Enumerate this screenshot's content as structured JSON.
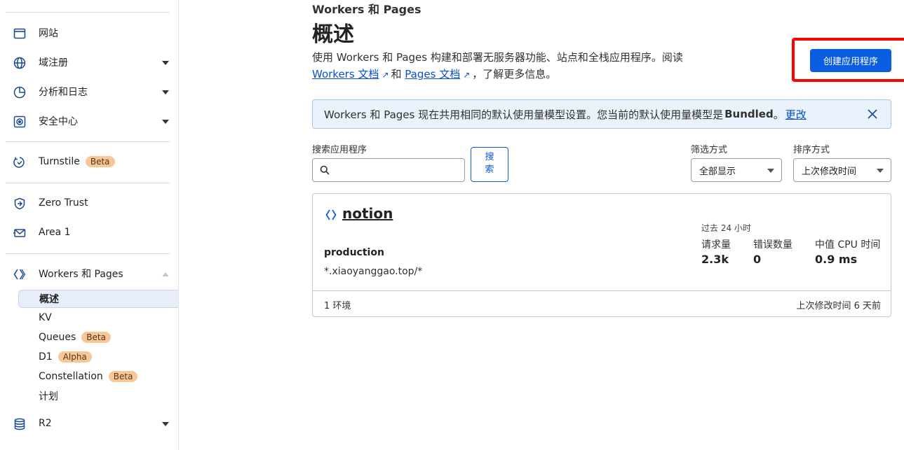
{
  "sidebar": {
    "items": [
      {
        "label": "网站",
        "icon": "browser-window-icon"
      },
      {
        "label": "域注册",
        "icon": "globe-icon"
      },
      {
        "label": "分析和日志",
        "icon": "pie-chart-icon"
      },
      {
        "label": "安全中心",
        "icon": "shield-target-icon"
      },
      {
        "label": "Turnstile",
        "icon": "turnstile-icon",
        "badge": "Beta"
      },
      {
        "label": "Zero Trust",
        "icon": "zero-trust-icon"
      },
      {
        "label": "Area 1",
        "icon": "mail-icon"
      },
      {
        "label": "Workers 和 Pages",
        "icon": "workers-icon"
      },
      {
        "label": "R2",
        "icon": "database-icon"
      }
    ],
    "subitems": [
      {
        "label": "概述",
        "active": true
      },
      {
        "label": "KV"
      },
      {
        "label": "Queues",
        "badge": "Beta"
      },
      {
        "label": "D1",
        "badge": "Alpha"
      },
      {
        "label": "Constellation",
        "badge": "Beta"
      },
      {
        "label": "计划"
      }
    ]
  },
  "header": {
    "breadcrumb": "Workers 和 Pages",
    "title": "概述",
    "description_prefix": "使用 Workers 和 Pages 构建和部署无服务器功能、站点和全栈应用程序。阅读",
    "workers_docs_link": "Workers 文档",
    "and_text": "和",
    "pages_docs_link": "Pages 文档",
    "description_suffix": "，了解更多信息。",
    "create_button": "创建应用程序"
  },
  "alert": {
    "text": "Workers 和 Pages 现在共用相同的默认使用量模型设置。您当前的默认使用量模型是",
    "model": "Bundled",
    "period": "。",
    "change_link": "更改"
  },
  "filters": {
    "search_label": "搜索应用程序",
    "search_placeholder": "",
    "search_button_line1": "搜",
    "search_button_line2": "索",
    "filter_label": "筛选方式",
    "filter_value": "全部显示",
    "sort_label": "排序方式",
    "sort_value": "上次修改时间"
  },
  "project": {
    "name": "notion",
    "environment": "production",
    "route": "*.xiaoyanggao.top/*",
    "stats_period": "过去 24 小时",
    "stats": [
      {
        "label": "请求量",
        "value": "2.3k"
      },
      {
        "label": "错误数量",
        "value": "0"
      },
      {
        "label": "中值 CPU 时间",
        "value": "0.9 ms"
      }
    ],
    "environments_count": "1 环境",
    "last_modified": "上次修改时间 6 天前"
  },
  "colors": {
    "accent": "#0a5ce0",
    "highlight_border": "#ff0000",
    "alert_bg": "#eaf2fc",
    "badge_bg": "#f7c79a",
    "icon": "#1f4a8f"
  }
}
